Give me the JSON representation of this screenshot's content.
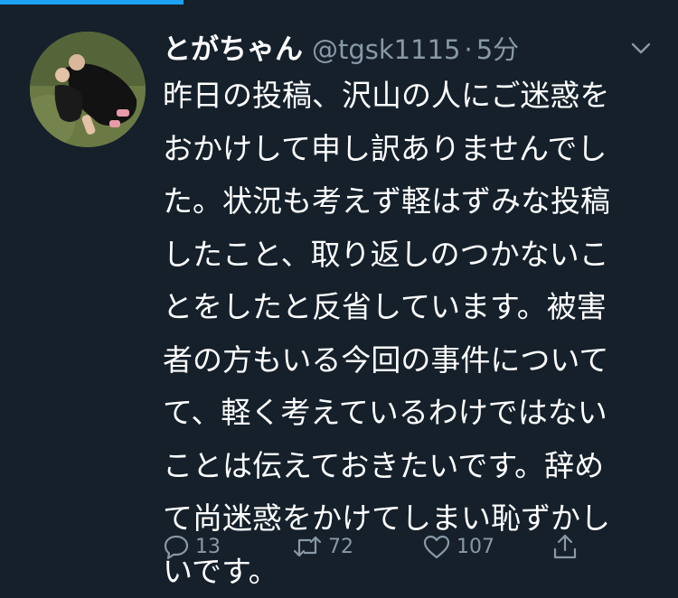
{
  "tweet": {
    "author": {
      "display_name": "とがちゃん",
      "handle": "@tgsk1115",
      "separator": "·",
      "time": "5分"
    },
    "text_lines": [
      "昨日の投稿、沢山の人にご迷惑を",
      "おかけして申し訳ありませんでし",
      "た。状況も考えず軽はずみな投稿",
      "したこと、取り返しのつかないこ",
      "とをしたと反省しています。被害",
      "者の方もいる今回の事件について",
      "て、軽く考えているわけではない",
      "ことは伝えておきたいです。辞め",
      "て尚迷惑をかけてしまい恥ずかし",
      "いです。"
    ],
    "actions": {
      "reply_count": "13",
      "retweet_count": "72",
      "like_count": "107"
    }
  },
  "icons": {
    "caret": "chevron-down-icon",
    "reply": "reply-icon",
    "retweet": "retweet-icon",
    "like": "heart-icon",
    "share": "share-icon"
  },
  "colors": {
    "background": "#15202b",
    "accent": "#1da1f2",
    "secondary_text": "#8899a6",
    "primary_text": "#ffffff"
  },
  "progress": 0.27
}
